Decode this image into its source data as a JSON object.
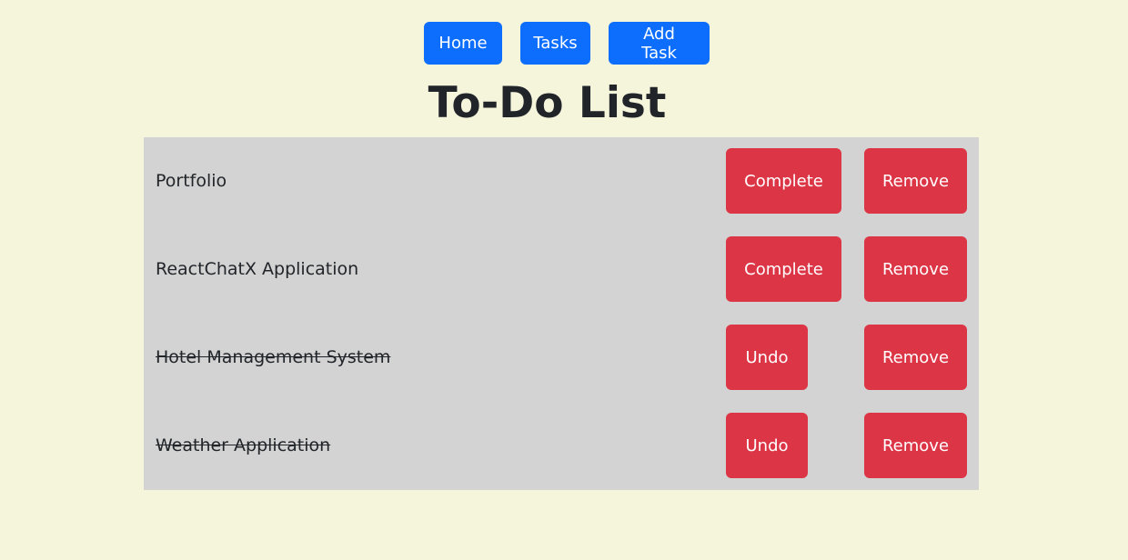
{
  "nav": {
    "home_label": "Home",
    "tasks_label": "Tasks",
    "add_task_label": "Add Task"
  },
  "page": {
    "title": "To-Do List"
  },
  "tasks": [
    {
      "name": "Portfolio",
      "completed": false,
      "toggle_label": "Complete",
      "remove_label": "Remove"
    },
    {
      "name": "ReactChatX Application",
      "completed": false,
      "toggle_label": "Complete",
      "remove_label": "Remove"
    },
    {
      "name": "Hotel Management System",
      "completed": true,
      "toggle_label": "Undo",
      "remove_label": "Remove"
    },
    {
      "name": "Weather Application",
      "completed": true,
      "toggle_label": "Undo",
      "remove_label": "Remove"
    }
  ],
  "colors": {
    "background": "#f5f5dc",
    "list_background": "#d3d3d3",
    "primary": "#0d6efd",
    "danger": "#dc3545",
    "text": "#212529"
  }
}
